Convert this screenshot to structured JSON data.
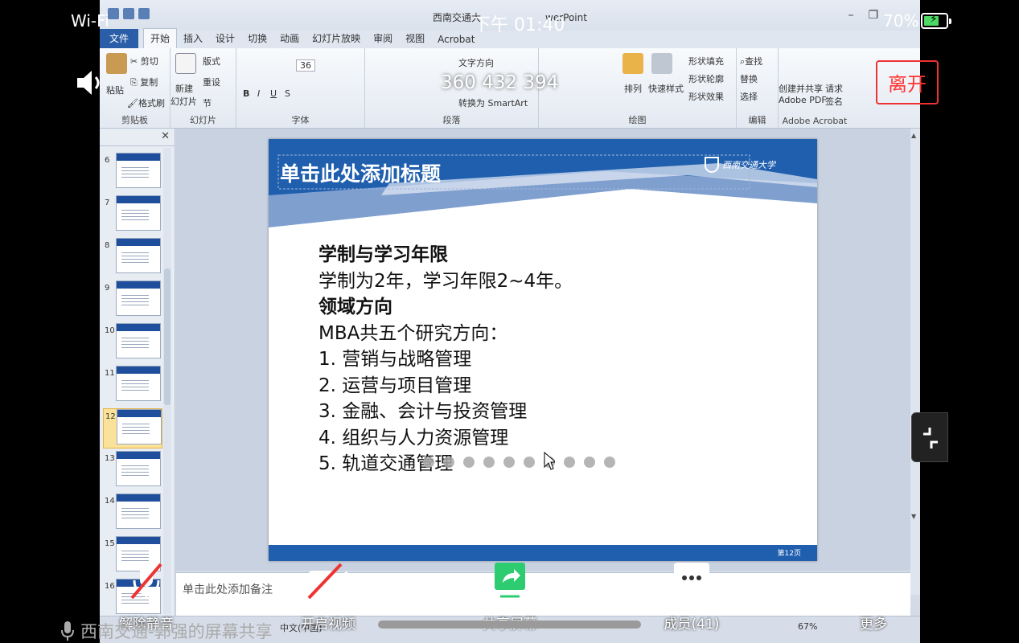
{
  "phone_status": {
    "network": "Wi-Fi",
    "time": "下午 01:40",
    "battery_percent": "70%",
    "battery_level": 0.7
  },
  "meeting": {
    "meeting_id": "360 432 394",
    "leave_label": "离开",
    "sharer_text": "西南交通-郭强的屏幕共享",
    "toolbar": [
      {
        "label": "解除静音",
        "icon": "mic-muted-icon"
      },
      {
        "label": "开启视频",
        "icon": "camera-off-icon"
      },
      {
        "label": "共享屏幕",
        "icon": "share-screen-icon"
      },
      {
        "label": "成员(41)",
        "icon": "members-icon"
      },
      {
        "label": "更多",
        "icon": "more-icon"
      }
    ],
    "accent_green": "#2ecc71",
    "leave_color": "#ee3333"
  },
  "powerpoint": {
    "window_title": "西南交通大",
    "window_title_suffix": "werPoint",
    "tabs": [
      "文件",
      "开始",
      "插入",
      "设计",
      "切换",
      "动画",
      "幻灯片放映",
      "审阅",
      "视图",
      "Acrobat"
    ],
    "active_tab": "开始",
    "ribbon": {
      "clipboard": {
        "label": "剪贴板",
        "paste": "粘贴",
        "cut": "剪切",
        "copy": "复制",
        "format_painter": "格式刷"
      },
      "slides": {
        "label": "幻灯片",
        "new_slide": "新建",
        "new_slide_line2": "幻灯片",
        "layout": "版式",
        "reset": "重设",
        "section": "节"
      },
      "font": {
        "label": "字体",
        "font_size": "36"
      },
      "paragraph": {
        "label": "段落",
        "text_direction": "文字方向",
        "convert_smartart": "转换为 SmartArt"
      },
      "drawing": {
        "label": "绘图",
        "arrange": "排列",
        "quick_styles": "快速样式",
        "shape_fill": "形状填充",
        "shape_outline": "形状轮廓",
        "shape_effects": "形状效果"
      },
      "editing": {
        "label": "编辑",
        "find": "查找",
        "replace": "替换",
        "select": "选择"
      },
      "acrobat": {
        "label": "Adobe Acrobat",
        "create_share": "创建并共享",
        "create_share_line2": "Adobe PDF",
        "request_sign": "请求",
        "request_sign_line2": "签名"
      }
    },
    "thumbnails": [
      "6",
      "7",
      "8",
      "9",
      "10",
      "11",
      "12",
      "13",
      "14",
      "15",
      "16"
    ],
    "selected_slide": "12",
    "slide": {
      "title": "单击此处添加标题",
      "logo_text": "西南交通大学",
      "page_label": "第12页",
      "lines": [
        {
          "text": "学制与学习年限",
          "bold": true
        },
        {
          "text": "学制为2年，学习年限2~4年。",
          "bold": false
        },
        {
          "text": "领域方向",
          "bold": true
        },
        {
          "text": "MBA共五个研究方向：",
          "bold": false
        },
        {
          "text": "1. 营销与战略管理",
          "bold": false
        },
        {
          "text": "2. 运营与项目管理",
          "bold": false
        },
        {
          "text": "3. 金融、会计与投资管理",
          "bold": false
        },
        {
          "text": "4. 组织与人力资源管理",
          "bold": false
        },
        {
          "text": "5. 轨道交通管理",
          "bold": false
        }
      ],
      "theme_blue": "#1f5fae"
    },
    "notes_placeholder": "单击此处添加备注",
    "status": {
      "language": "中文(中国)",
      "zoom": "67%"
    }
  }
}
